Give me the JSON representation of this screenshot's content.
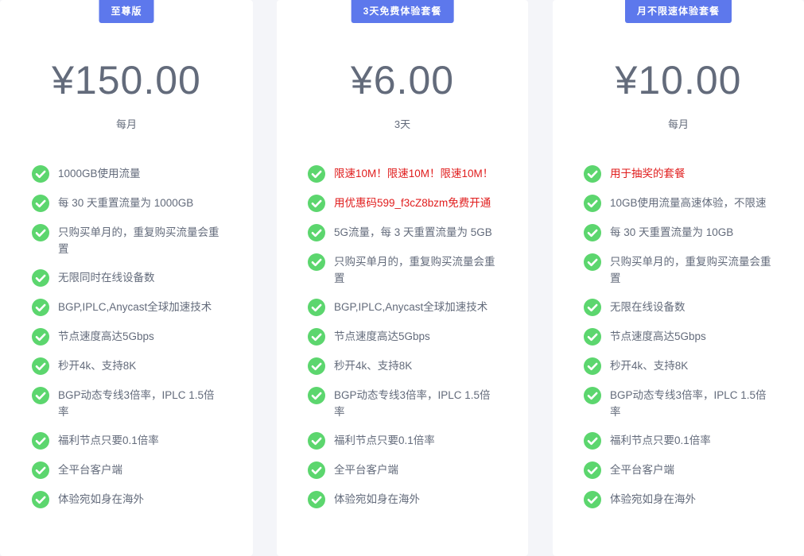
{
  "plans": [
    {
      "badge": "至尊版",
      "price": "¥150.00",
      "period": "每月",
      "features": [
        {
          "text": "1000GB使用流量",
          "highlight": false
        },
        {
          "text": "每 30 天重置流量为 1000GB",
          "highlight": false
        },
        {
          "text": "只购买单月的，重复购买流量会重置",
          "highlight": false
        },
        {
          "text": "无限同时在线设备数",
          "highlight": false
        },
        {
          "text": "BGP,IPLC,Anycast全球加速技术",
          "highlight": false
        },
        {
          "text": "节点速度高达5Gbps",
          "highlight": false
        },
        {
          "text": "秒开4k、支持8K",
          "highlight": false
        },
        {
          "text": "BGP动态专线3倍率，IPLC 1.5倍率",
          "highlight": false
        },
        {
          "text": "福利节点只要0.1倍率",
          "highlight": false
        },
        {
          "text": "全平台客户端",
          "highlight": false
        },
        {
          "text": "体验宛如身在海外",
          "highlight": false
        }
      ]
    },
    {
      "badge": "3天免费体验套餐",
      "price": "¥6.00",
      "period": "3天",
      "features": [
        {
          "text": "限速10M！限速10M！限速10M！",
          "highlight": true
        },
        {
          "text": "用优惠码599_f3cZ8bzm免费开通",
          "highlight": true
        },
        {
          "text": "5G流量，每 3 天重置流量为 5GB",
          "highlight": false
        },
        {
          "text": "只购买单月的，重复购买流量会重置",
          "highlight": false
        },
        {
          "text": "BGP,IPLC,Anycast全球加速技术",
          "highlight": false
        },
        {
          "text": "节点速度高达5Gbps",
          "highlight": false
        },
        {
          "text": "秒开4k、支持8K",
          "highlight": false
        },
        {
          "text": "BGP动态专线3倍率，IPLC 1.5倍率",
          "highlight": false
        },
        {
          "text": "福利节点只要0.1倍率",
          "highlight": false
        },
        {
          "text": "全平台客户端",
          "highlight": false
        },
        {
          "text": "体验宛如身在海外",
          "highlight": false
        }
      ]
    },
    {
      "badge": "月不限速体验套餐",
      "price": "¥10.00",
      "period": "每月",
      "features": [
        {
          "text": "用于抽奖的套餐",
          "highlight": true
        },
        {
          "text": "10GB使用流量高速体验，不限速",
          "highlight": false
        },
        {
          "text": "每 30 天重置流量为 10GB",
          "highlight": false
        },
        {
          "text": "只购买单月的，重复购买流量会重置",
          "highlight": false
        },
        {
          "text": "无限在线设备数",
          "highlight": false
        },
        {
          "text": "节点速度高达5Gbps",
          "highlight": false
        },
        {
          "text": "秒开4k、支持8K",
          "highlight": false
        },
        {
          "text": "BGP动态专线3倍率，IPLC 1.5倍率",
          "highlight": false
        },
        {
          "text": "福利节点只要0.1倍率",
          "highlight": false
        },
        {
          "text": "全平台客户端",
          "highlight": false
        },
        {
          "text": "体验宛如身在海外",
          "highlight": false
        }
      ]
    }
  ],
  "icons": {
    "feature_check": "check-circle-icon"
  },
  "colors": {
    "badge_bg": "#5d78ec",
    "check_green": "#5cd66e",
    "highlight_red": "#e01c1c",
    "text_gray": "#636b7b"
  }
}
